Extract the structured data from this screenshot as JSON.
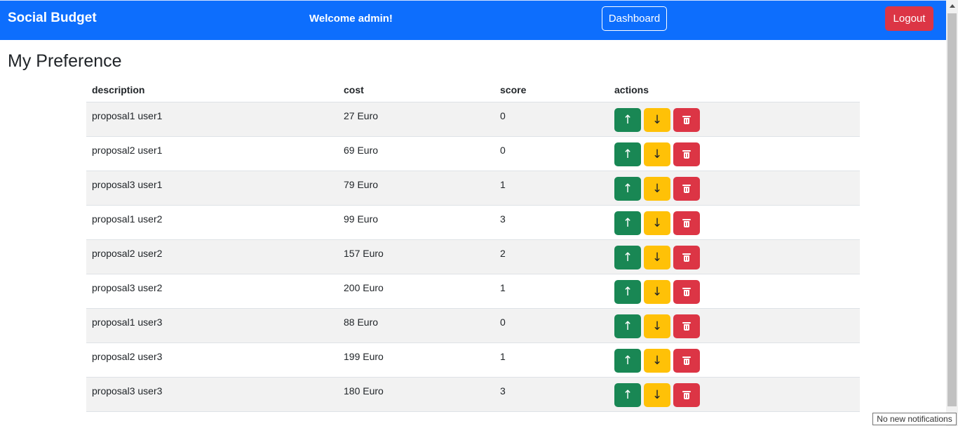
{
  "navbar": {
    "brand": "Social Budget",
    "welcome": "Welcome admin!",
    "dashboard_label": "Dashboard",
    "logout_label": "Logout",
    "color": "#0d6efd"
  },
  "page": {
    "title": "My Preference"
  },
  "table": {
    "headers": [
      "description",
      "cost",
      "score",
      "actions"
    ],
    "rows": [
      {
        "description": "proposal1 user1",
        "cost": "27 Euro",
        "score": "0"
      },
      {
        "description": "proposal2 user1",
        "cost": "69 Euro",
        "score": "0"
      },
      {
        "description": "proposal3 user1",
        "cost": "79 Euro",
        "score": "1"
      },
      {
        "description": "proposal1 user2",
        "cost": "99 Euro",
        "score": "3"
      },
      {
        "description": "proposal2 user2",
        "cost": "157 Euro",
        "score": "2"
      },
      {
        "description": "proposal3 user2",
        "cost": "200 Euro",
        "score": "1"
      },
      {
        "description": "proposal1 user3",
        "cost": "88 Euro",
        "score": "0"
      },
      {
        "description": "proposal2 user3",
        "cost": "199 Euro",
        "score": "1"
      },
      {
        "description": "proposal3 user3",
        "cost": "180 Euro",
        "score": "3"
      }
    ],
    "action_icons": {
      "up": "arrow-up-icon",
      "down": "arrow-down-icon",
      "delete": "trash-icon"
    },
    "action_colors": {
      "up": "#198754",
      "down": "#ffc107",
      "delete": "#dc3545"
    }
  },
  "toast": {
    "text": "No new notifications"
  }
}
